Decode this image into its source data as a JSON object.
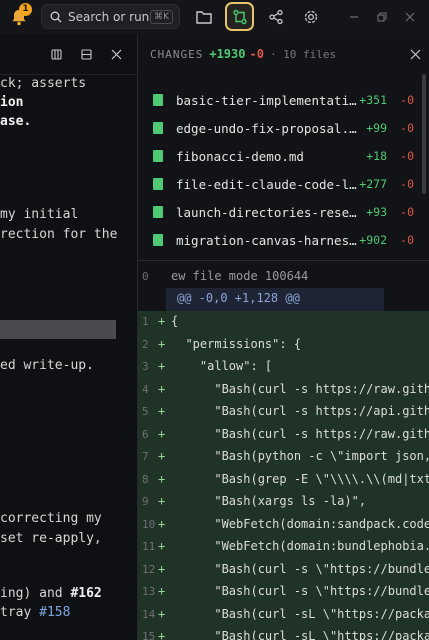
{
  "topbar": {
    "notification_count": "1",
    "search_placeholder": "Search or run",
    "search_shortcut": "⌘K"
  },
  "left_panel": {
    "lines": [
      {
        "text": "ck; asserts",
        "style": "normal"
      },
      {
        "text": "ion",
        "style": "bold"
      },
      {
        "text": "ase.",
        "style": "bold"
      },
      {
        "text": "my initial",
        "style": "normal"
      },
      {
        "text": "rection for the",
        "style": "normal"
      },
      {
        "text": "ed write-up.",
        "style": "normal"
      },
      {
        "text": "correcting my",
        "style": "normal"
      },
      {
        "text": "set re-apply,",
        "style": "normal"
      },
      {
        "text": "ing) and ",
        "style": "normal",
        "suffix": "#162"
      },
      {
        "text": "tray ",
        "style": "normal",
        "link": "#158"
      }
    ]
  },
  "changes": {
    "title": "CHANGES",
    "additions": "+1930",
    "deletions": "-0",
    "files_count": "· 10 files",
    "files": [
      {
        "name": "basic-tier-implementation.md",
        "add": "+351",
        "del": "-0"
      },
      {
        "name": "edge-undo-fix-proposal.md",
        "add": "+99",
        "del": "-0"
      },
      {
        "name": "fibonacci-demo.md",
        "add": "+18",
        "del": "-0"
      },
      {
        "name": "file-edit-claude-code-log.md",
        "add": "+277",
        "del": "-0"
      },
      {
        "name": "launch-directories-research.md",
        "add": "+93",
        "del": "-0"
      },
      {
        "name": "migration-canvas-harness.md",
        "add": "+902",
        "del": "-0"
      }
    ]
  },
  "diff": {
    "meta": "ew file mode 100644",
    "meta_num": "0",
    "hunk": "@@ -0,0 +1,128 @@",
    "lines": [
      {
        "num": "1",
        "sign": "+",
        "code": "{"
      },
      {
        "num": "2",
        "sign": "+",
        "code": "  \"permissions\": {"
      },
      {
        "num": "3",
        "sign": "+",
        "code": "    \"allow\": ["
      },
      {
        "num": "4",
        "sign": "+",
        "code": "      \"Bash(curl -s https://raw.githubusercontent"
      },
      {
        "num": "5",
        "sign": "+",
        "code": "      \"Bash(curl -s https://api.github.com"
      },
      {
        "num": "6",
        "sign": "+",
        "code": "      \"Bash(curl -s https://raw.githubusercontent"
      },
      {
        "num": "7",
        "sign": "+",
        "code": "      \"Bash(python -c \\\"import json,"
      },
      {
        "num": "8",
        "sign": "+",
        "code": "      \"Bash(grep -E \\\"\\\\\\\\.\\\\(md|txt"
      },
      {
        "num": "9",
        "sign": "+",
        "code": "      \"Bash(xargs ls -la)\","
      },
      {
        "num": "10",
        "sign": "+",
        "code": "      \"WebFetch(domain:sandpack.codesandbox"
      },
      {
        "num": "11",
        "sign": "+",
        "code": "      \"WebFetch(domain:bundlephobia.com"
      },
      {
        "num": "12",
        "sign": "+",
        "code": "      \"Bash(curl -s \\\"https://bundlephobia"
      },
      {
        "num": "13",
        "sign": "+",
        "code": "      \"Bash(curl -s \\\"https://bundlephobia"
      },
      {
        "num": "14",
        "sign": "+",
        "code": "      \"Bash(curl -sL \\\"https://packagephobia"
      },
      {
        "num": "15",
        "sign": "+",
        "code": "      \"Bash(curl -sL \\\"https://packagephobia"
      }
    ]
  },
  "colors": {
    "accent": "#e9c46a",
    "add": "#4ec974",
    "del": "#e0584b"
  }
}
